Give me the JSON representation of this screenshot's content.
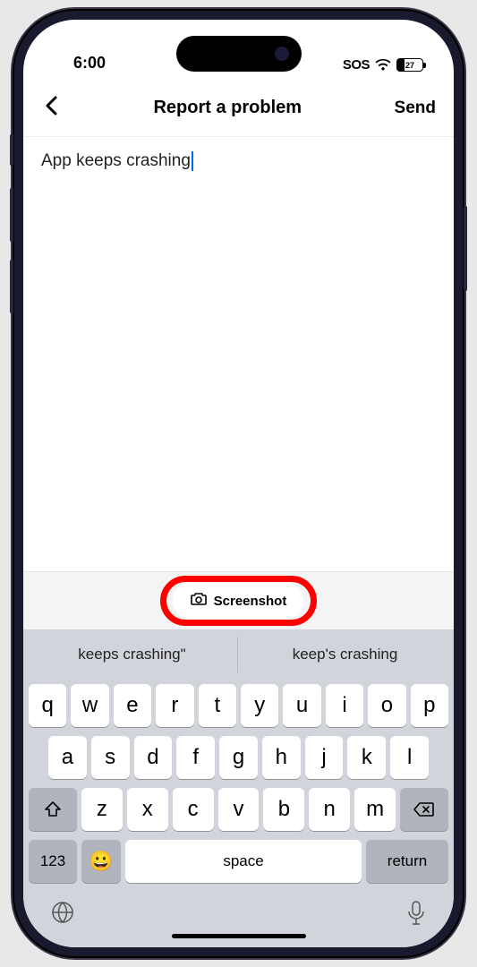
{
  "status": {
    "time": "6:00",
    "sos": "SOS",
    "battery": "27"
  },
  "nav": {
    "title": "Report a problem",
    "send": "Send"
  },
  "input": {
    "value": "App keeps crashing"
  },
  "screenshot": {
    "label": "Screenshot"
  },
  "suggestions": [
    "keeps crashing\"",
    "keep's crashing"
  ],
  "keyboard": {
    "row1": [
      "q",
      "w",
      "e",
      "r",
      "t",
      "y",
      "u",
      "i",
      "o",
      "p"
    ],
    "row2": [
      "a",
      "s",
      "d",
      "f",
      "g",
      "h",
      "j",
      "k",
      "l"
    ],
    "row3": [
      "z",
      "x",
      "c",
      "v",
      "b",
      "n",
      "m"
    ],
    "space": "space",
    "return": "return",
    "numbers": "123"
  }
}
